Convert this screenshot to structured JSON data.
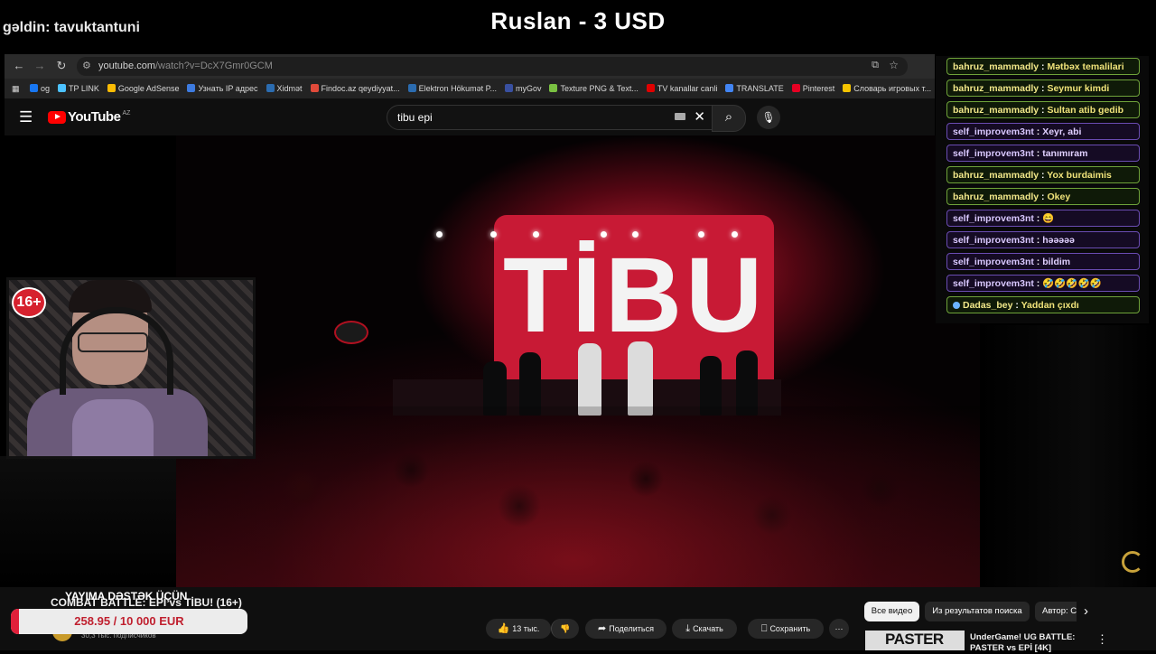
{
  "overlay": {
    "joined_text": "gəldin: tavuktantuni",
    "donation_title": "Ruslan - 3 USD",
    "age_badge": "16+"
  },
  "browser": {
    "url_host": "youtube.com",
    "url_path": "/watch?v=DcX7Gmr0GCM",
    "bookmarks": [
      {
        "label": "og",
        "color": "#1877f2"
      },
      {
        "label": "TP LINK",
        "color": "#4cc2ff"
      },
      {
        "label": "Google AdSense",
        "color": "#fbbc04"
      },
      {
        "label": "Узнать IP адрес",
        "color": "#3d7be0"
      },
      {
        "label": "Xidmət",
        "color": "#2b6cb0"
      },
      {
        "label": "Findoc.az qeydiyyat...",
        "color": "#e04a3a"
      },
      {
        "label": "Elektron Hökumət P...",
        "color": "#2b6cb0"
      },
      {
        "label": "myGov",
        "color": "#3950a0"
      },
      {
        "label": "Texture PNG & Text...",
        "color": "#7ac142"
      },
      {
        "label": "TV kanallar canli",
        "color": "#e00000"
      },
      {
        "label": "TRANSLATE",
        "color": "#4285f4"
      },
      {
        "label": "Pinterest",
        "color": "#e60023"
      },
      {
        "label": "Словарь игровых т...",
        "color": "#f5c400"
      }
    ]
  },
  "youtube": {
    "logo_text": "YouTube",
    "country_code": "AZ",
    "search_value": "tibu epi"
  },
  "video": {
    "stage_text": "TİBU"
  },
  "chat": {
    "messages": [
      {
        "user": "bahruz_mammadly",
        "text": "Mətbəx temalilari",
        "style": "green"
      },
      {
        "user": "bahruz_mammadly",
        "text": "Seymur kimdi",
        "style": "green"
      },
      {
        "user": "bahruz_mammadly",
        "text": "Sultan atib gedib",
        "style": "green"
      },
      {
        "user": "self_improvem3nt",
        "text": "Xeyr, abi",
        "style": "purple"
      },
      {
        "user": "self_improvem3nt",
        "text": "tanımıram",
        "style": "purple"
      },
      {
        "user": "bahruz_mammadly",
        "text": "Yox burdaimis",
        "style": "green"
      },
      {
        "user": "bahruz_mammadly",
        "text": "Okey",
        "style": "green"
      },
      {
        "user": "self_improvem3nt",
        "text": "😄",
        "style": "purple"
      },
      {
        "user": "self_improvem3nt",
        "text": "həəəəə",
        "style": "purple"
      },
      {
        "user": "self_improvem3nt",
        "text": "bildim",
        "style": "purple"
      },
      {
        "user": "self_improvem3nt",
        "text": "🤣🤣🤣🤣🤣",
        "style": "purple"
      },
      {
        "user": "Dadas_bey",
        "text": "Yaddan çıxdı",
        "style": "green"
      }
    ]
  },
  "video_info": {
    "support_label": "YAYIMA DƏSTƏK ÜÇÜN",
    "title": "COMBAT BATTLE: EPİ vs TİBU! (16+)",
    "subscribers": "30,3 тыс. подписчиков",
    "likes": "13 тыс.",
    "share_label": "Поделиться",
    "download_label": "Скачать",
    "save_label": "Сохранить"
  },
  "donation_goal": {
    "text": "258.95 / 10 000 EUR",
    "progress": 0.0259
  },
  "filters": {
    "all_label": "Все видео",
    "search_label": "Из результатов поиска",
    "author_label": "Автор: C"
  },
  "recommendation": {
    "thumb_text": "PASTER",
    "title": "UnderGame! UG BATTLE: PASTER vs EPİ [4K]"
  }
}
